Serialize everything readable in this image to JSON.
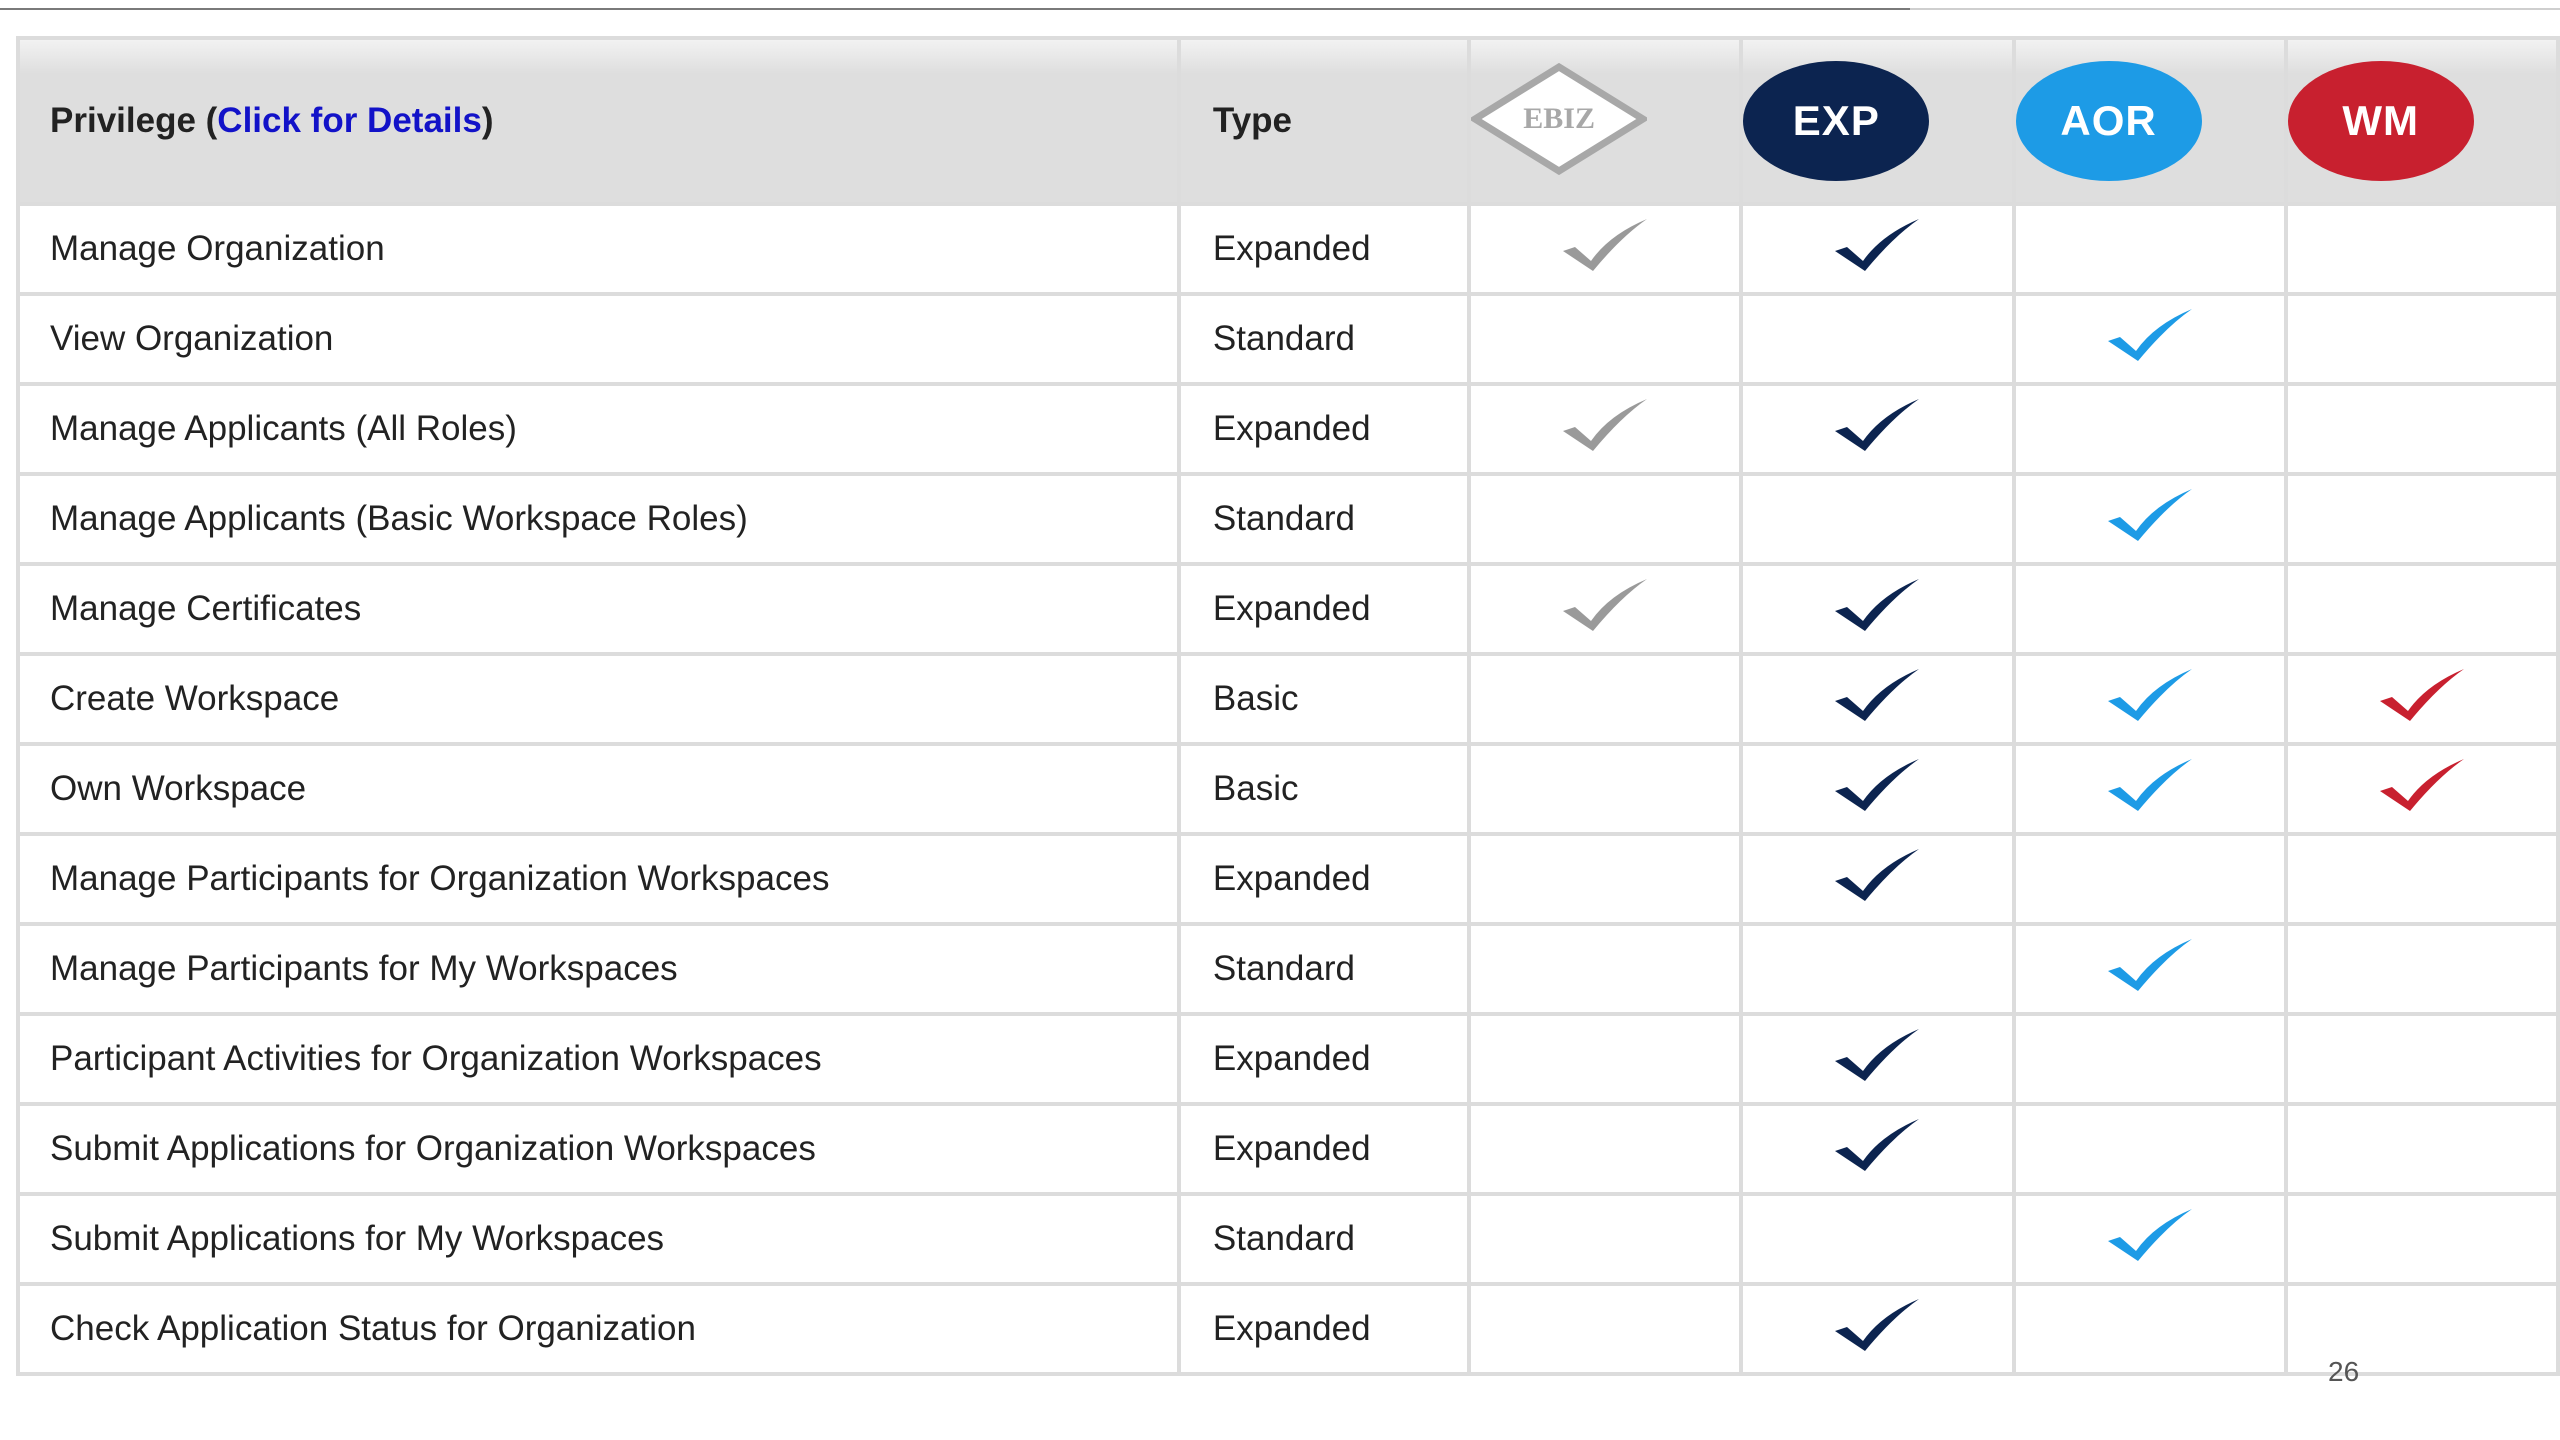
{
  "header": {
    "privilege_label": "Privilege (",
    "privilege_link": "Click for Details",
    "privilege_close": ")",
    "type_label": "Type"
  },
  "roles": [
    {
      "key": "EBIZ",
      "label": "EBIZ",
      "style": "diamond",
      "color": "#9a9a9a"
    },
    {
      "key": "EXP",
      "label": "EXP",
      "style": "circle",
      "color": "#0c2450"
    },
    {
      "key": "AOR",
      "label": "AOR",
      "style": "circle",
      "color": "#1d9be6"
    },
    {
      "key": "WM",
      "label": "WM",
      "style": "circle",
      "color": "#c8202f"
    }
  ],
  "rows": [
    {
      "privilege": "Manage Organization",
      "type": "Expanded",
      "checks": [
        true,
        true,
        false,
        false
      ]
    },
    {
      "privilege": "View Organization",
      "type": "Standard",
      "checks": [
        false,
        false,
        true,
        false
      ]
    },
    {
      "privilege": "Manage Applicants (All Roles)",
      "type": "Expanded",
      "checks": [
        true,
        true,
        false,
        false
      ]
    },
    {
      "privilege": "Manage Applicants (Basic Workspace Roles)",
      "type": "Standard",
      "checks": [
        false,
        false,
        true,
        false
      ]
    },
    {
      "privilege": "Manage Certificates",
      "type": "Expanded",
      "checks": [
        true,
        true,
        false,
        false
      ]
    },
    {
      "privilege": "Create Workspace",
      "type": "Basic",
      "checks": [
        false,
        true,
        true,
        true
      ]
    },
    {
      "privilege": "Own Workspace",
      "type": "Basic",
      "checks": [
        false,
        true,
        true,
        true
      ]
    },
    {
      "privilege": "Manage Participants for Organization Workspaces",
      "type": "Expanded",
      "checks": [
        false,
        true,
        false,
        false
      ]
    },
    {
      "privilege": "Manage Participants for My Workspaces",
      "type": "Standard",
      "checks": [
        false,
        false,
        true,
        false
      ]
    },
    {
      "privilege": "Participant Activities for Organization Workspaces",
      "type": "Expanded",
      "checks": [
        false,
        true,
        false,
        false
      ]
    },
    {
      "privilege": "Submit Applications for Organization Workspaces",
      "type": "Expanded",
      "checks": [
        false,
        true,
        false,
        false
      ]
    },
    {
      "privilege": "Submit Applications for My Workspaces",
      "type": "Standard",
      "checks": [
        false,
        false,
        true,
        false
      ]
    },
    {
      "privilege": "Check Application Status for Organization",
      "type": "Expanded",
      "checks": [
        false,
        true,
        false,
        false
      ]
    }
  ],
  "check_colors": [
    "#9a9a9a",
    "#0c2450",
    "#1d9be6",
    "#c8202f"
  ],
  "slide_number": "26"
}
